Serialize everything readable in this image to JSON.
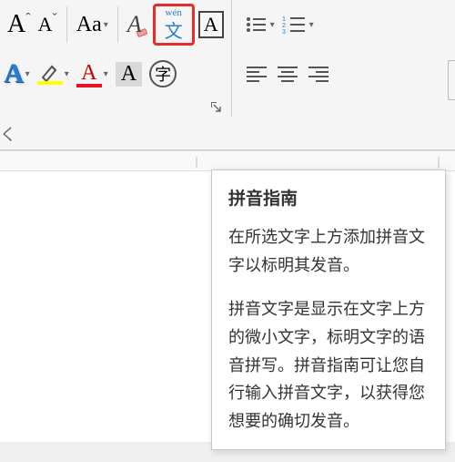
{
  "ribbon": {
    "row1": {
      "grow_font": "A",
      "grow_sup": "ˆ",
      "shrink_font": "A",
      "shrink_sup": "ˇ",
      "change_case": "Aa",
      "clear_format": "A",
      "phonetic_top": "wén",
      "phonetic_bottom": "文",
      "char_border": "A",
      "bullets": "•",
      "numbering": "1"
    },
    "row2": {
      "text_effects": "A",
      "highlight": "",
      "font_color": "A",
      "char_shading": "A",
      "enclose": "字",
      "align_left": "",
      "align_center": "",
      "align_right": ""
    },
    "tab_letter": "く"
  },
  "ruler": {
    "mark1": "｜",
    "mark2": "｜"
  },
  "tooltip": {
    "title": "拼音指南",
    "p1": "在所选文字上方添加拼音文字以标明其发音。",
    "p2": "拼音文字是显示在文字上方的微小文字，标明文字的语音拼写。拼音指南可让您自行输入拼音文字，以获得您想要的确切发音。"
  }
}
